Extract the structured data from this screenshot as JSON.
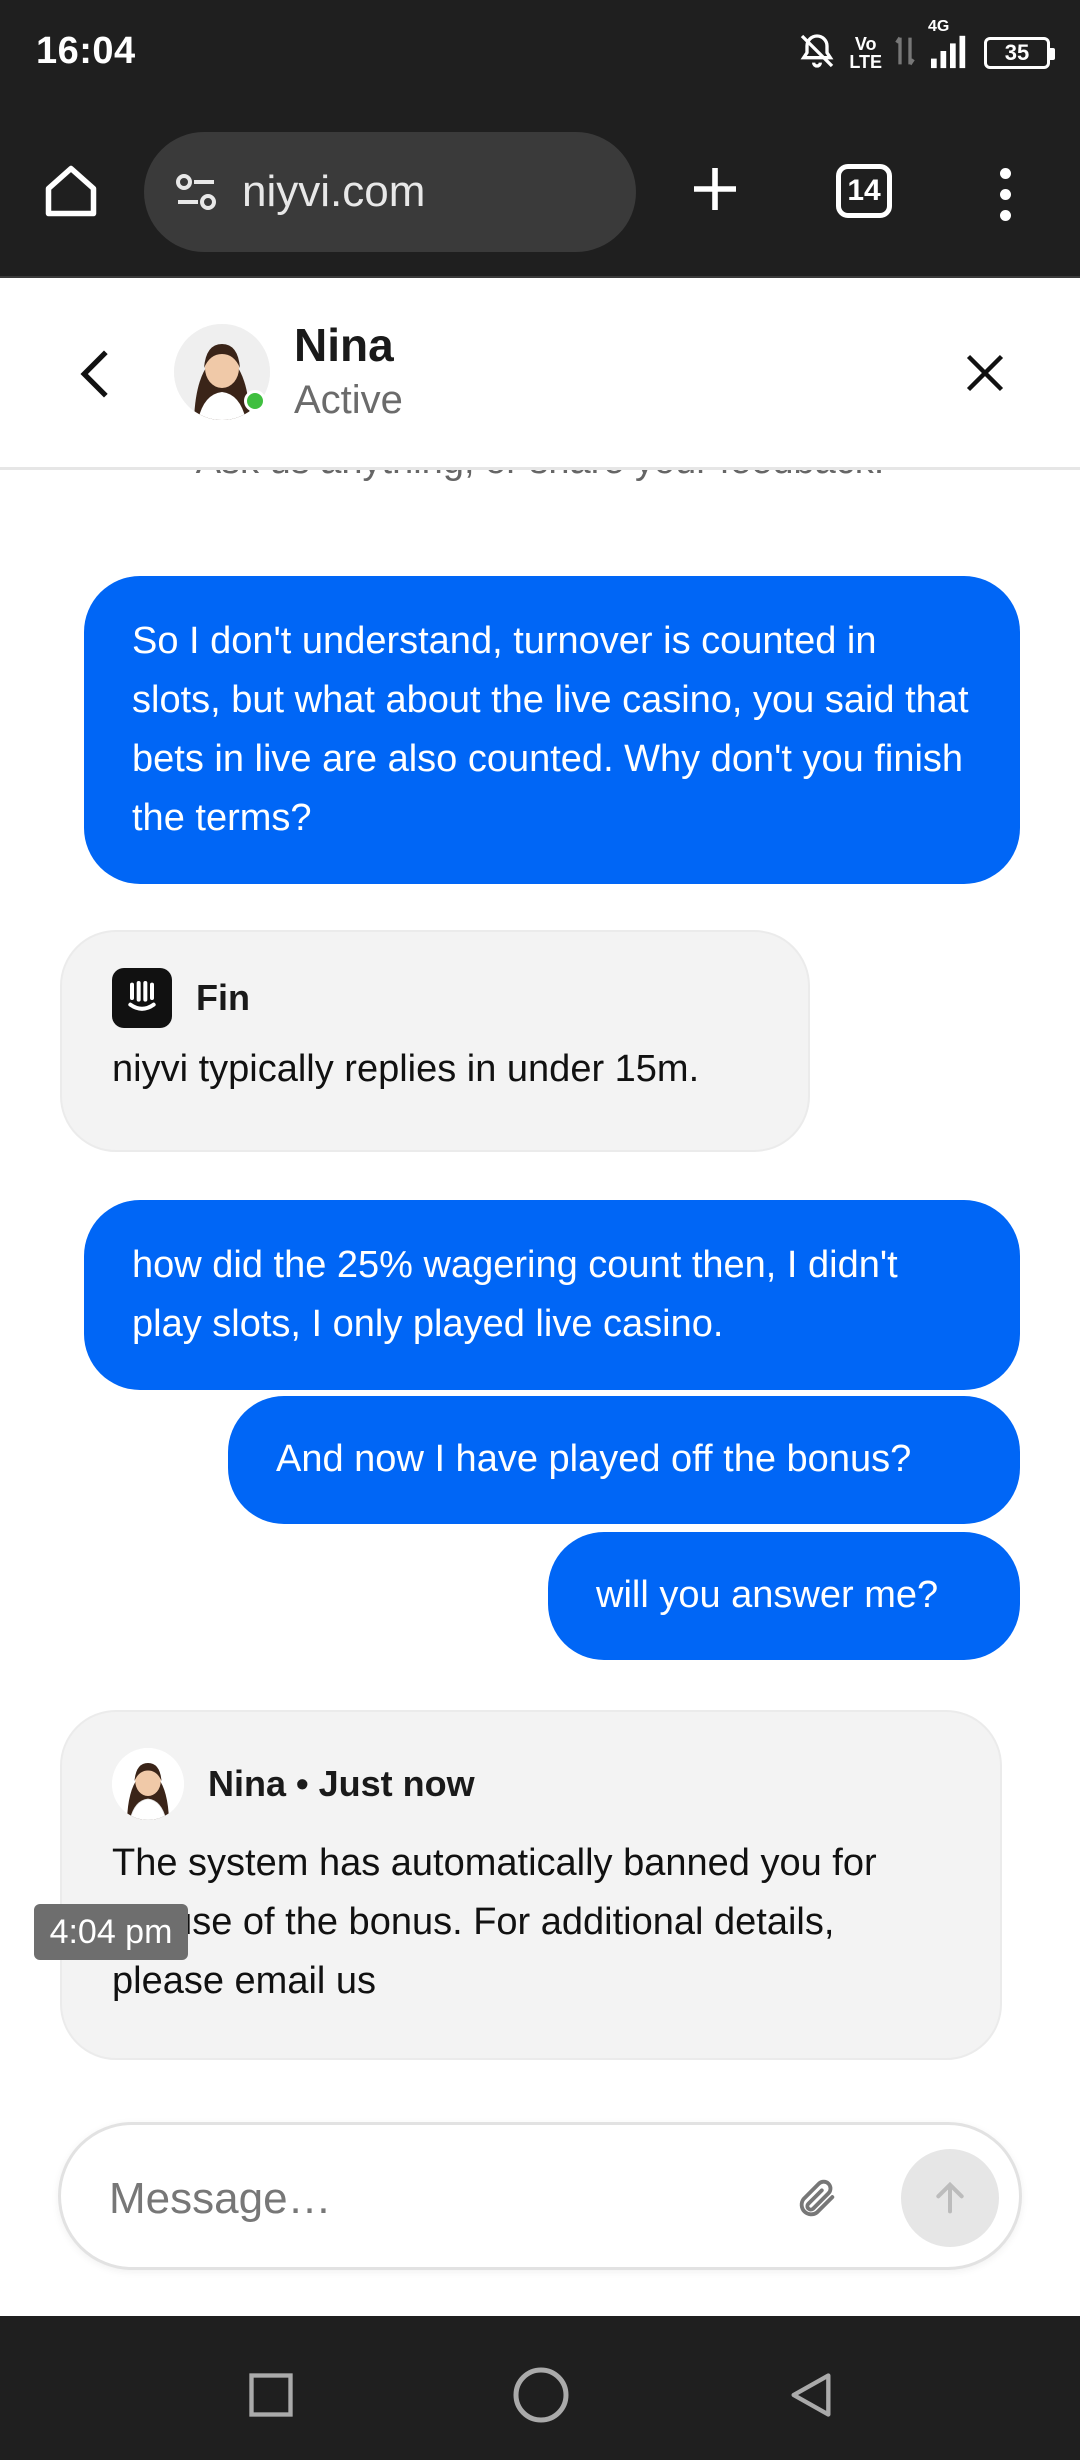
{
  "status_bar": {
    "time": "16:04",
    "network_volte_top": "Vo",
    "network_volte_bottom": "LTE",
    "network_type": "4G",
    "battery": "35"
  },
  "browser": {
    "url": "niyvi.com",
    "tab_count": "14"
  },
  "header": {
    "agent_name": "Nina",
    "agent_status": "Active"
  },
  "chat": {
    "intro": "Ask us anything, or share your feedback.",
    "messages": [
      {
        "from": "user",
        "text": "So I don't understand, turnover is counted in slots, but what about the live casino, you said that bets in live are also counted. Why don't you finish the terms?"
      },
      {
        "from": "bot",
        "name": "Fin",
        "text": "niyvi typically replies in under 15m."
      },
      {
        "from": "user",
        "text": "how did the 25% wagering count then, I didn't play slots, I only played live casino."
      },
      {
        "from": "user",
        "text": "And now I have played off the bonus?"
      },
      {
        "from": "user",
        "text": "will you answer me?"
      },
      {
        "from": "agent",
        "name": "Nina • Just now",
        "text": "The system has automatically banned you for misuse of the bonus. For additional details, please email us"
      }
    ],
    "timestamp_tooltip": "4:04 pm"
  },
  "composer": {
    "placeholder": "Message…"
  },
  "colors": {
    "accent": "#0066f6",
    "bot_bubble": "#f3f3f3",
    "online": "#3fbf3f",
    "chrome": "#1f1f1f"
  }
}
